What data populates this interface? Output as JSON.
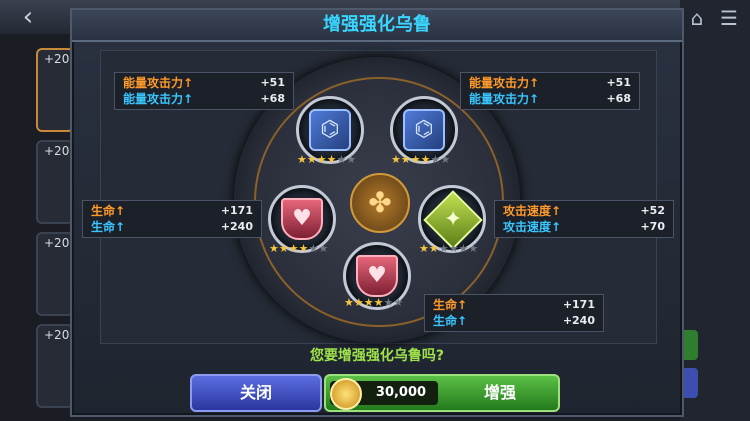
{
  "dialog": {
    "title": "增强强化乌鲁",
    "question": "您要增强强化乌鲁吗?",
    "close_label": "关闭",
    "enhance_label": "增强",
    "cost": "30,000"
  },
  "background": {
    "back_icon": "‹",
    "slots": [
      "+20",
      "+20",
      "+20",
      "+20"
    ]
  },
  "stat_boxes": [
    {
      "line1": "能量攻击力↑",
      "val1": "+51",
      "line2": "能量攻击力↑",
      "val2": "+68"
    },
    {
      "line1": "能量攻击力↑",
      "val1": "+51",
      "line2": "能量攻击力↑",
      "val2": "+68"
    },
    {
      "line1": "生命↑",
      "val1": "+171",
      "line2": "生命↑",
      "val2": "+240"
    },
    {
      "line1": "攻击速度↑",
      "val1": "+52",
      "line2": "攻击速度↑",
      "val2": "+70"
    },
    {
      "line1": "生命↑",
      "val1": "+171",
      "line2": "生命↑",
      "val2": "+240"
    }
  ],
  "runes": [
    {
      "type": "energy-rune-icon",
      "stars_filled": 4,
      "stars_total": 6
    },
    {
      "type": "energy-rune-icon",
      "stars_filled": 4,
      "stars_total": 6
    },
    {
      "type": "health-rune-icon",
      "stars_filled": 4,
      "stars_total": 6
    },
    {
      "type": "speed-rune-icon",
      "stars_filled": 2,
      "stars_total": 6
    },
    {
      "type": "health-rune-icon",
      "stars_filled": 4,
      "stars_total": 6
    }
  ],
  "colors": {
    "title": "#39d6ff",
    "stat_orange": "#ff9a2a",
    "stat_blue": "#39c6ff",
    "question": "#9fe34a",
    "close_button": "#3d4bc0",
    "enhance_button": "#3a9a2e"
  }
}
